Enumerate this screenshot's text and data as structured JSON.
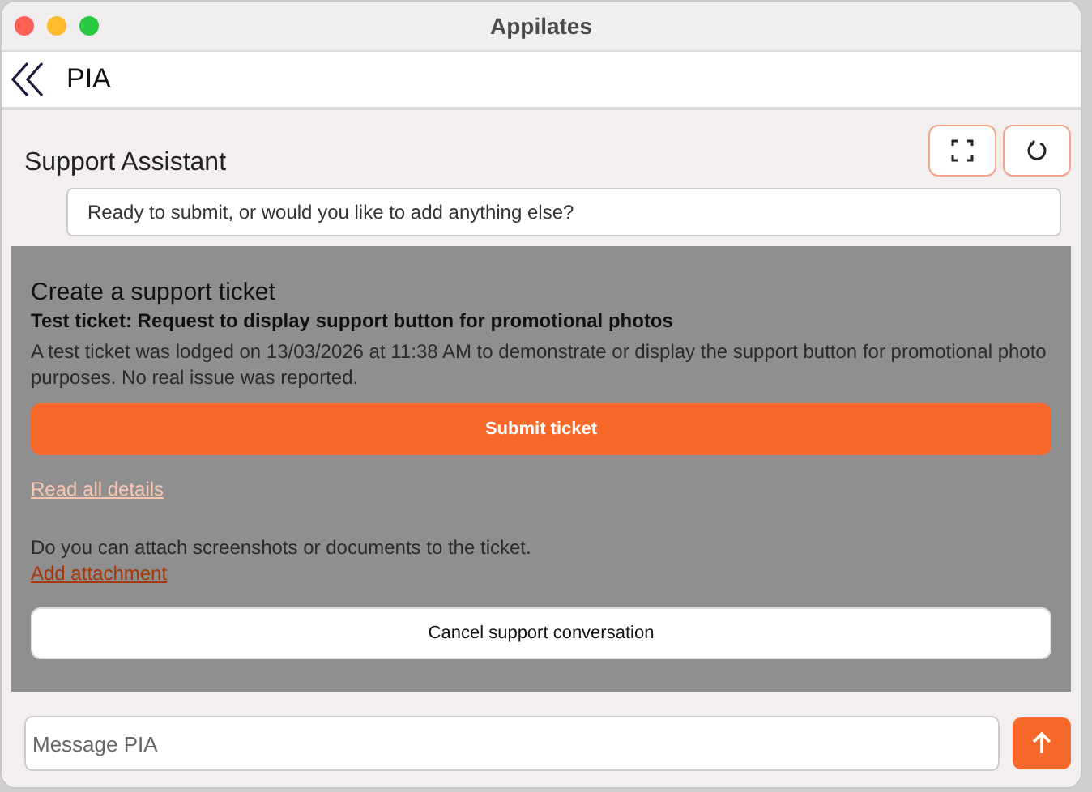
{
  "window": {
    "title": "Appilates"
  },
  "nav": {
    "title": "PIA"
  },
  "assistant": {
    "title": "Support Assistant",
    "last_message": "Ready to submit, or would you like to add anything else?"
  },
  "ticket": {
    "heading": "Create a support ticket",
    "subject": "Test ticket: Request to display support button for promotional photos",
    "description": "A test ticket was lodged on 13/03/2026 at 11:38 AM to demonstrate or display the support button for promotional photo purposes. No real issue was reported.",
    "submit": "Submit ticket",
    "details_link": "Read all details",
    "attach_note": "Do you can attach screenshots or documents to the ticket.",
    "attach_link": "Add attachment",
    "cancel": "Cancel support conversation"
  },
  "composer": {
    "placeholder": "Message PIA"
  }
}
